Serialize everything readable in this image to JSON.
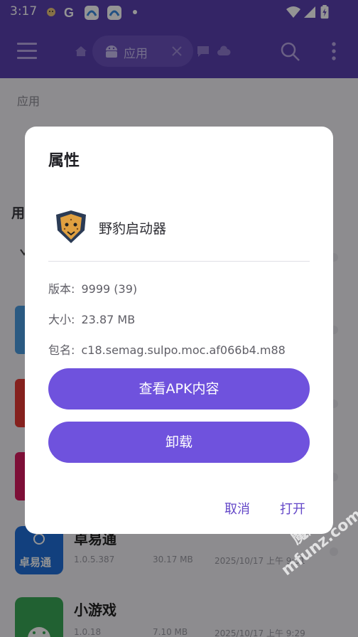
{
  "status_bar": {
    "time": "3:17",
    "notification_icons": [
      "leopard-notification-icon",
      "google-icon",
      "app-notification-icon",
      "app-notification-icon",
      "dot-icon"
    ],
    "system_icons": [
      "wifi-icon",
      "cellular-icon",
      "battery-icon"
    ]
  },
  "app_bar": {
    "tab_label": "应用",
    "icons": [
      "menu-icon",
      "home-icon",
      "android-icon",
      "close-icon",
      "chat-icon",
      "cloud-icon",
      "search-icon",
      "more-vert-icon"
    ],
    "color": "#5b40b0"
  },
  "background": {
    "section_title": "应用",
    "sub_title": "用",
    "apps": [
      {
        "name": "卓易通",
        "version": "1.0.5.387",
        "size": "30.17 MB",
        "date": "2025/10/17 上午 9:51",
        "icon_label": "卓易通"
      },
      {
        "name": "小游戏",
        "version": "1.0.18",
        "size": "7.10 MB",
        "date": "2025/10/17 上午 9:29"
      }
    ]
  },
  "dialog": {
    "title": "属性",
    "app_name": "野豹启动器",
    "version_label": "版本:",
    "version_value": "9999 (39)",
    "size_label": "大小:",
    "size_value": "23.87 MB",
    "package_label": "包名:",
    "package_value": "c18.semag.sulpo.moc.af066b4.m88",
    "view_apk_button": "查看APK内容",
    "uninstall_button": "卸载",
    "cancel_button": "取消",
    "open_button": "打开",
    "accent": "#6f52dd"
  },
  "watermark": {
    "brand": "魔趣网",
    "url": "mfunz.com"
  }
}
